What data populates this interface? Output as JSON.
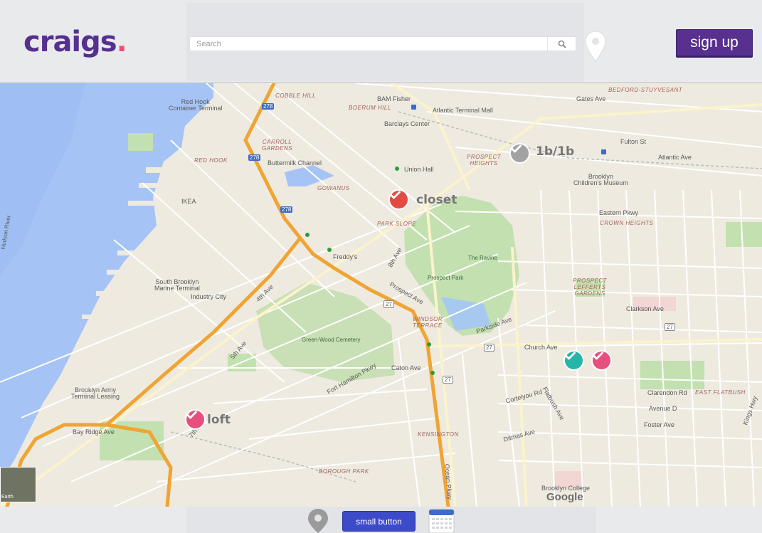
{
  "header": {
    "logo_text": "craigs",
    "logo_dot": ".",
    "search_placeholder": "Search",
    "signup_label": "sign up"
  },
  "map": {
    "listings": [
      {
        "label": "1b/1b",
        "color": "#a2a2a2",
        "icon": "check-icon"
      },
      {
        "label": "closet",
        "color": "#e34a42",
        "icon": "check-icon"
      },
      {
        "label": "loft",
        "color": "#e84f7e",
        "icon": "check-icon"
      },
      {
        "label": "",
        "color": "#26b5a9",
        "icon": "check-icon"
      },
      {
        "label": "",
        "color": "#e84f7e",
        "icon": "check-icon"
      }
    ],
    "place_labels": {
      "red_hook_container": "Red Hook\nContainer Terminal",
      "cobble_hill": "COBBLE HILL",
      "boerum_hill": "BOERUM HILL",
      "bam_fisher": "BAM Fisher",
      "atlantic_terminal": "Atlantic Terminal Mall",
      "barclays": "Barclays Center",
      "carroll_gardens": "CARROLL\nGARDENS",
      "buttermilk": "Buttermilk Channel",
      "red_hook": "RED HOOK",
      "gowanus": "GOWANUS",
      "union_hall": "Union Hall",
      "prospect_heights": "PROSPECT\nHEIGHTS",
      "brooklyn_childrens": "Brooklyn\nChildren's Museum",
      "ikea": "IKEA",
      "park_slope": "PARK SLOPE",
      "freddys": "Freddy's",
      "the_ravine": "The Ravine",
      "prospect_park": "Prospect Park",
      "crown_heights": "CROWN HEIGHTS",
      "eastern_pkwy": "Eastern Pkwy",
      "south_brooklyn_marine": "South Brooklyn\nMarine Terminal",
      "industry_city": "Industry City",
      "prospect_lefferts": "PROSPECT\nLEFFERTS\nGARDENS",
      "clarkson_ave": "Clarkson Ave",
      "windsor_terrace": "WINDSOR\nTERRACE",
      "green_wood": "Green-Wood Cemetery",
      "church_ave": "Church Ave",
      "caton_ave": "Caton Ave",
      "east_flatbush": "EAST FLATBUSH",
      "brooklyn_army": "Brooklyn Army\nTerminal Leasing",
      "bay_ridge_ave": "Bay Ridge Ave",
      "kensington": "KENSINGTON",
      "borough_park": "BOROUGH PARK",
      "brooklyn_college": "Brooklyn College",
      "hudson_river": "Hudson River",
      "atlantic_ave": "Atlantic Ave",
      "fulton_st": "Fulton St",
      "gates_ave": "Gates Ave",
      "bedford_stuyvesant": "BEDFORD-STUYVESANT",
      "prospect_ave": "Prospect Ave",
      "parkside_ave": "Parkside Ave",
      "foster_ave": "Foster Ave",
      "avenue_d": "Avenue D",
      "clarendon_rd": "Clarendon Rd",
      "ditmas_ave": "Ditmas Ave",
      "cortelyou_rd": "Cortelyou Rd",
      "fort_hamilton_pkwy": "Fort Hamilton Pkwy",
      "ocean_pkwy": "Ocean Pkwy",
      "flatbush_ave": "Flatbush Ave",
      "kings_hwy": "Kings Hwy",
      "seventh_ave": "7th Ave",
      "fourth_ave": "4th Ave",
      "fifth_ave": "5th Ave",
      "eighth_ave": "8th Ave"
    },
    "route_shields": [
      "278",
      "278",
      "278",
      "27",
      "27",
      "27",
      "27"
    ],
    "attribution": "Google",
    "earth_label": "Earth"
  },
  "toolbar": {
    "small_button_label": "small button"
  }
}
